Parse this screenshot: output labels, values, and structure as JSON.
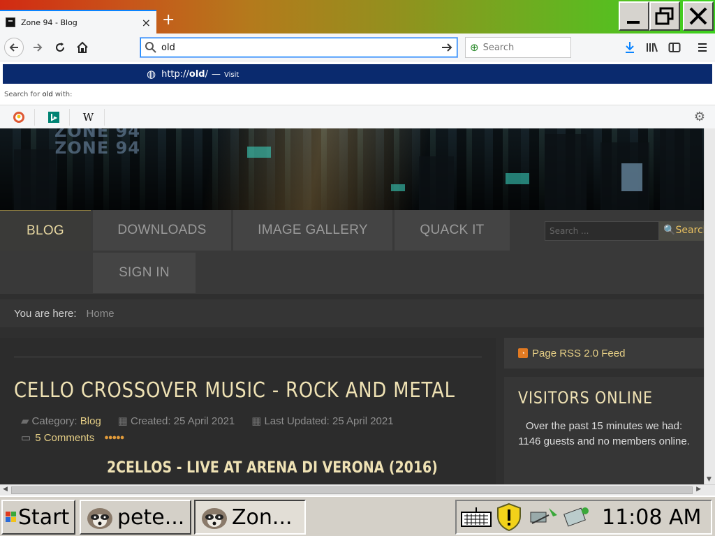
{
  "browser": {
    "tab_title": "Zone 94 - Blog",
    "tab_close": "×",
    "new_tab": "+",
    "url_value": "old",
    "search_placeholder": "Search",
    "suggestion": {
      "url_prefix": "http://",
      "url_bold": "old",
      "url_suffix": "/",
      "separator": "—",
      "action": "Visit"
    },
    "search_for_prefix": "Search for ",
    "search_for_term": "old",
    "search_for_suffix": " with:",
    "engines": [
      "duckduckgo",
      "bing",
      "wikipedia"
    ],
    "accent": "#0a84ff"
  },
  "site": {
    "logo_lines": [
      "ZONE 94",
      "ZONE 94"
    ],
    "menu": [
      {
        "label": "BLOG",
        "active": true
      },
      {
        "label": "DOWNLOADS",
        "active": false
      },
      {
        "label": "IMAGE GALLERY",
        "active": false
      },
      {
        "label": "QUACK IT",
        "active": false
      },
      {
        "label": "SIGN IN",
        "active": false
      }
    ],
    "search_placeholder": "Search ...",
    "search_button": "Search",
    "breadcrumb_label": "You are here:",
    "breadcrumb_home": "Home"
  },
  "article": {
    "title": "CELLO CROSSOVER MUSIC - ROCK AND METAL",
    "category_label": "Category:",
    "category": "Blog",
    "created": "Created: 25 April 2021",
    "updated": "Last Updated: 25 April 2021",
    "comments": "5 Comments",
    "rating": 5,
    "subtitle": "2CELLOS - LIVE AT ARENA DI VERONA (2016)"
  },
  "sidebar": {
    "rss": "Page RSS 2.0 Feed",
    "visitors_title": "VISITORS ONLINE",
    "visitors_text": "Over the past 15 minutes we had: 1146 guests and no members online."
  },
  "taskbar": {
    "start": "Start",
    "tasks": [
      "pete...",
      "Zon..."
    ],
    "clock": "11:08 AM"
  }
}
